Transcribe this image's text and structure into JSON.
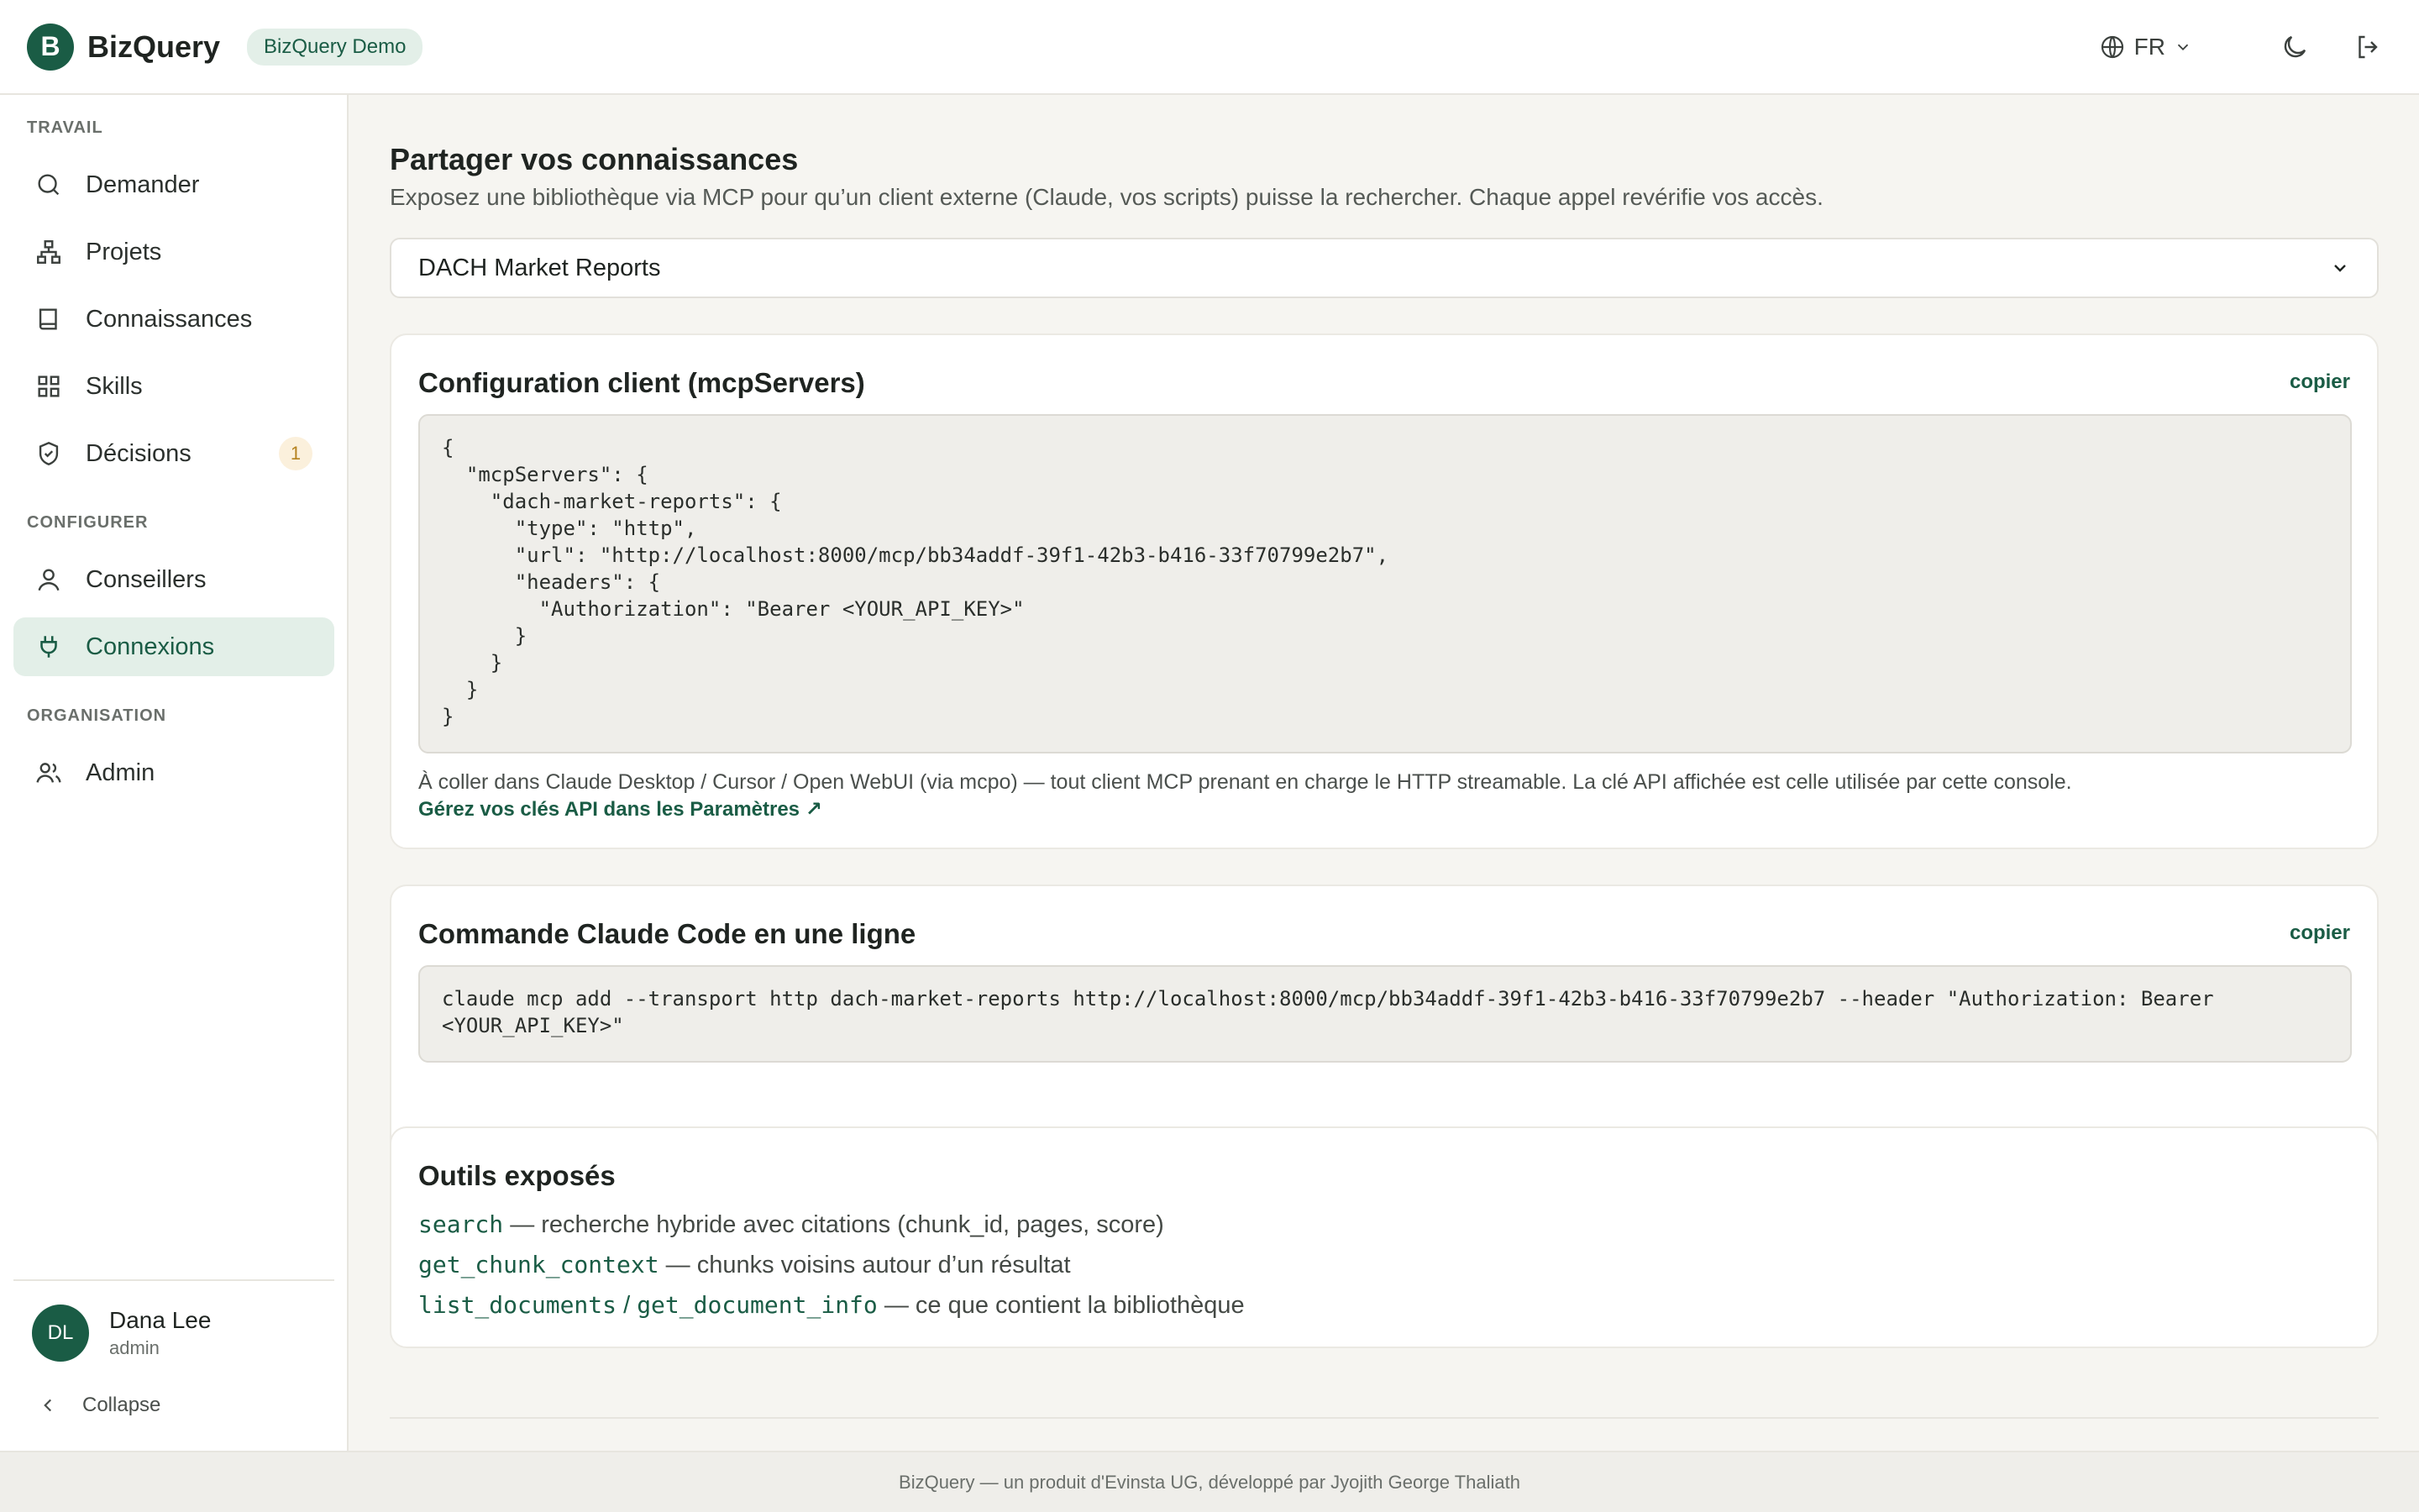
{
  "header": {
    "logo_letter": "B",
    "app_name": "BizQuery",
    "demo_badge": "BizQuery Demo",
    "language": "FR"
  },
  "sidebar": {
    "sections": [
      {
        "label": "TRAVAIL"
      },
      {
        "label": "CONFIGURER"
      },
      {
        "label": "ORGANISATION"
      }
    ],
    "items": [
      {
        "label": "Demander",
        "icon": "search-icon"
      },
      {
        "label": "Projets",
        "icon": "hierarchy-icon"
      },
      {
        "label": "Connaissances",
        "icon": "book-icon"
      },
      {
        "label": "Skills",
        "icon": "grid-icon"
      },
      {
        "label": "Décisions",
        "icon": "shield-check-icon",
        "badge": "1"
      },
      {
        "label": "Conseillers",
        "icon": "user-icon"
      },
      {
        "label": "Connexions",
        "icon": "plug-icon",
        "active": true
      },
      {
        "label": "Admin",
        "icon": "users-icon"
      }
    ],
    "user": {
      "initials": "DL",
      "name": "Dana Lee",
      "role": "admin"
    },
    "collapse_label": "Collapse"
  },
  "main": {
    "title": "Partager vos connaissances",
    "subtitle": "Exposez une bibliothèque via MCP pour qu’un client externe (Claude, vos scripts) puisse la rechercher. Chaque appel revérifie vos accès.",
    "library_select": "DACH Market Reports",
    "config_card": {
      "title": "Configuration client (mcpServers)",
      "copy_label": "copier",
      "code": "{\n  \"mcpServers\": {\n    \"dach-market-reports\": {\n      \"type\": \"http\",\n      \"url\": \"http://localhost:8000/mcp/bb34addf-39f1-42b3-b416-33f70799e2b7\",\n      \"headers\": {\n        \"Authorization\": \"Bearer <YOUR_API_KEY>\"\n      }\n    }\n  }\n}",
      "note": "À coller dans Claude Desktop / Cursor / Open WebUI (via mcpo) — tout client MCP prenant en charge le HTTP streamable. La clé API affichée est celle utilisée par cette console.",
      "link": "Gérez vos clés API dans les Paramètres ↗"
    },
    "command_card": {
      "title": "Commande Claude Code en une ligne",
      "copy_label": "copier",
      "code": "claude mcp add --transport http dach-market-reports http://localhost:8000/mcp/bb34addf-39f1-42b3-b416-33f70799e2b7 --header \"Authorization: Bearer\n<YOUR_API_KEY>\""
    },
    "tools_card": {
      "title": "Outils exposés",
      "tools": [
        {
          "names": [
            "search"
          ],
          "desc": " — recherche hybride avec citations (chunk_id, pages, score)"
        },
        {
          "names": [
            "get_chunk_context"
          ],
          "desc": " — chunks voisins autour d’un résultat"
        },
        {
          "names": [
            "list_documents",
            "get_document_info"
          ],
          "desc": " — ce que contient la bibliothèque"
        }
      ],
      "separator": " / "
    }
  },
  "footer": {
    "text": "BizQuery — un produit d'Evinsta UG, développé par Jyojith George Thaliath"
  },
  "colors": {
    "accent": "#1a5c45",
    "accent_light": "#e3efe8",
    "badge_bg": "#fbf0dc",
    "badge_text": "#b5821f"
  }
}
